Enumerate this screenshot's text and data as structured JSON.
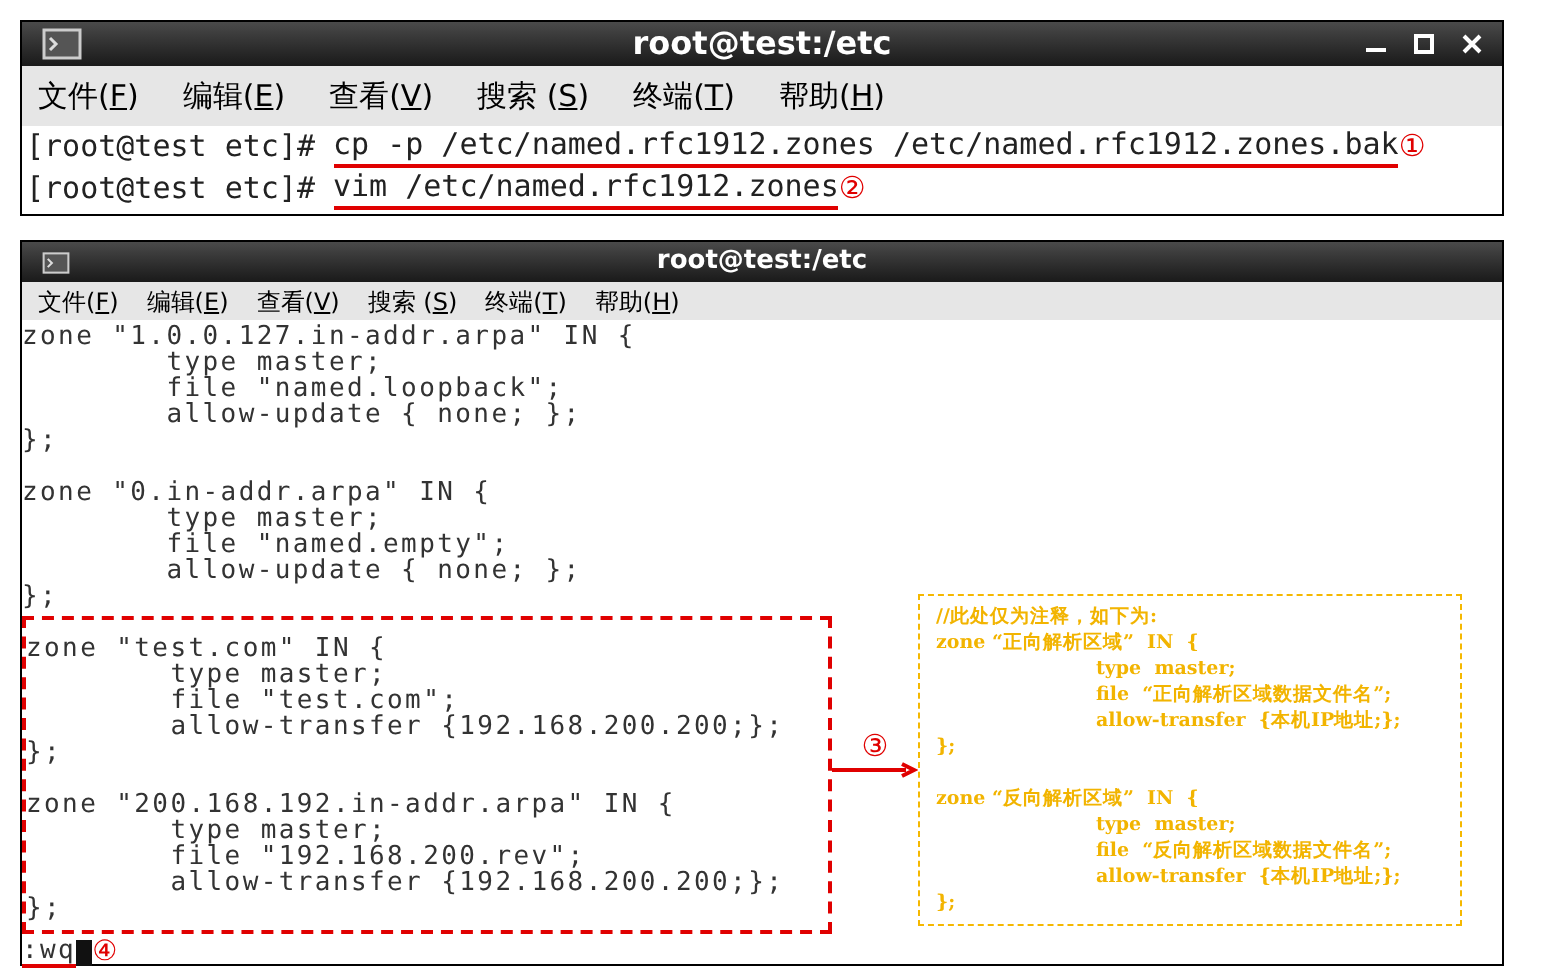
{
  "top_window": {
    "title": "root@test:/etc",
    "menu": [
      {
        "before": "文件(",
        "key": "F",
        "after": ")"
      },
      {
        "before": "编辑(",
        "key": "E",
        "after": ")"
      },
      {
        "before": "查看(",
        "key": "V",
        "after": ")"
      },
      {
        "before": "搜索 (",
        "key": "S",
        "after": ")"
      },
      {
        "before": "终端(",
        "key": "T",
        "after": ")"
      },
      {
        "before": "帮助(",
        "key": "H",
        "after": ")"
      }
    ],
    "lines": [
      {
        "prompt": "[root@test etc]#",
        "command": "cp -p /etc/named.rfc1912.zones /etc/named.rfc1912.zones.bak",
        "step": "①"
      },
      {
        "prompt": "[root@test etc]#",
        "command": "vim /etc/named.rfc1912.zones",
        "step": "②"
      }
    ]
  },
  "bottom_window": {
    "title": "root@test:/etc",
    "menu": [
      {
        "before": "文件(",
        "key": "F",
        "after": ")"
      },
      {
        "before": "编辑(",
        "key": "E",
        "after": ")"
      },
      {
        "before": "查看(",
        "key": "V",
        "after": ")"
      },
      {
        "before": "搜索 (",
        "key": "S",
        "after": ")"
      },
      {
        "before": "终端(",
        "key": "T",
        "after": ")"
      },
      {
        "before": "帮助(",
        "key": "H",
        "after": ")"
      }
    ],
    "code_blocks": [
      {
        "lines": [
          "zone \"1.0.0.127.in-addr.arpa\" IN {",
          "        type master;",
          "        file \"named.loopback\";",
          "        allow-update { none; };",
          "};"
        ]
      },
      {
        "lines": [
          "zone \"0.in-addr.arpa\" IN {",
          "        type master;",
          "        file \"named.empty\";",
          "        allow-update { none; };",
          "};"
        ]
      }
    ],
    "highlighted_blocks": [
      {
        "lines": [
          "zone \"test.com\" IN {",
          "        type master;",
          "        file \"test.com\";",
          "        allow-transfer {192.168.200.200;};",
          "};"
        ]
      },
      {
        "lines": [
          "zone \"200.168.192.in-addr.arpa\" IN {",
          "        type master;",
          "        file \"192.168.200.rev\";",
          "        allow-transfer {192.168.200.200;};",
          "};"
        ]
      }
    ],
    "callout_step": "③",
    "note": {
      "comment": "//此处仅为注释，如下为:",
      "blocks": [
        {
          "header": "zone “正向解析区域”  IN  {",
          "body": [
            "type  master;",
            "file  “正向解析区域数据文件名”;",
            "allow-transfer  {本机IP地址;};"
          ],
          "footer": "};"
        },
        {
          "header": "zone “反向解析区域”  IN  {",
          "body": [
            "type  master;",
            "file  “反向解析区域数据文件名”;",
            "allow-transfer  {本机IP地址;};"
          ],
          "footer": "};"
        }
      ]
    },
    "command_line": ":wq",
    "command_step": "④"
  }
}
